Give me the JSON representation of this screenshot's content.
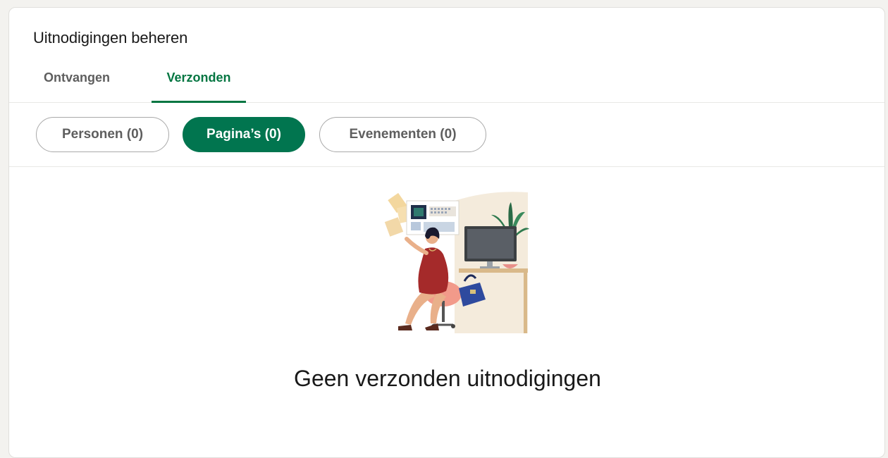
{
  "card": {
    "title": "Uitnodigingen beheren"
  },
  "tabs": [
    {
      "label": "Ontvangen",
      "active": false
    },
    {
      "label": "Verzonden",
      "active": true
    }
  ],
  "filters": [
    {
      "label": "Personen (0)",
      "active": false
    },
    {
      "label": "Pagina’s (0)",
      "active": true
    },
    {
      "label": "Evenementen (0)",
      "active": false
    }
  ],
  "empty_state": {
    "message": "Geen verzonden uitnodigingen",
    "illustration": "woman-at-desk-illustration"
  },
  "colors": {
    "accent": "#01754f",
    "tab_active": "#057642",
    "text": "#191919",
    "muted": "#5e5e5e"
  }
}
